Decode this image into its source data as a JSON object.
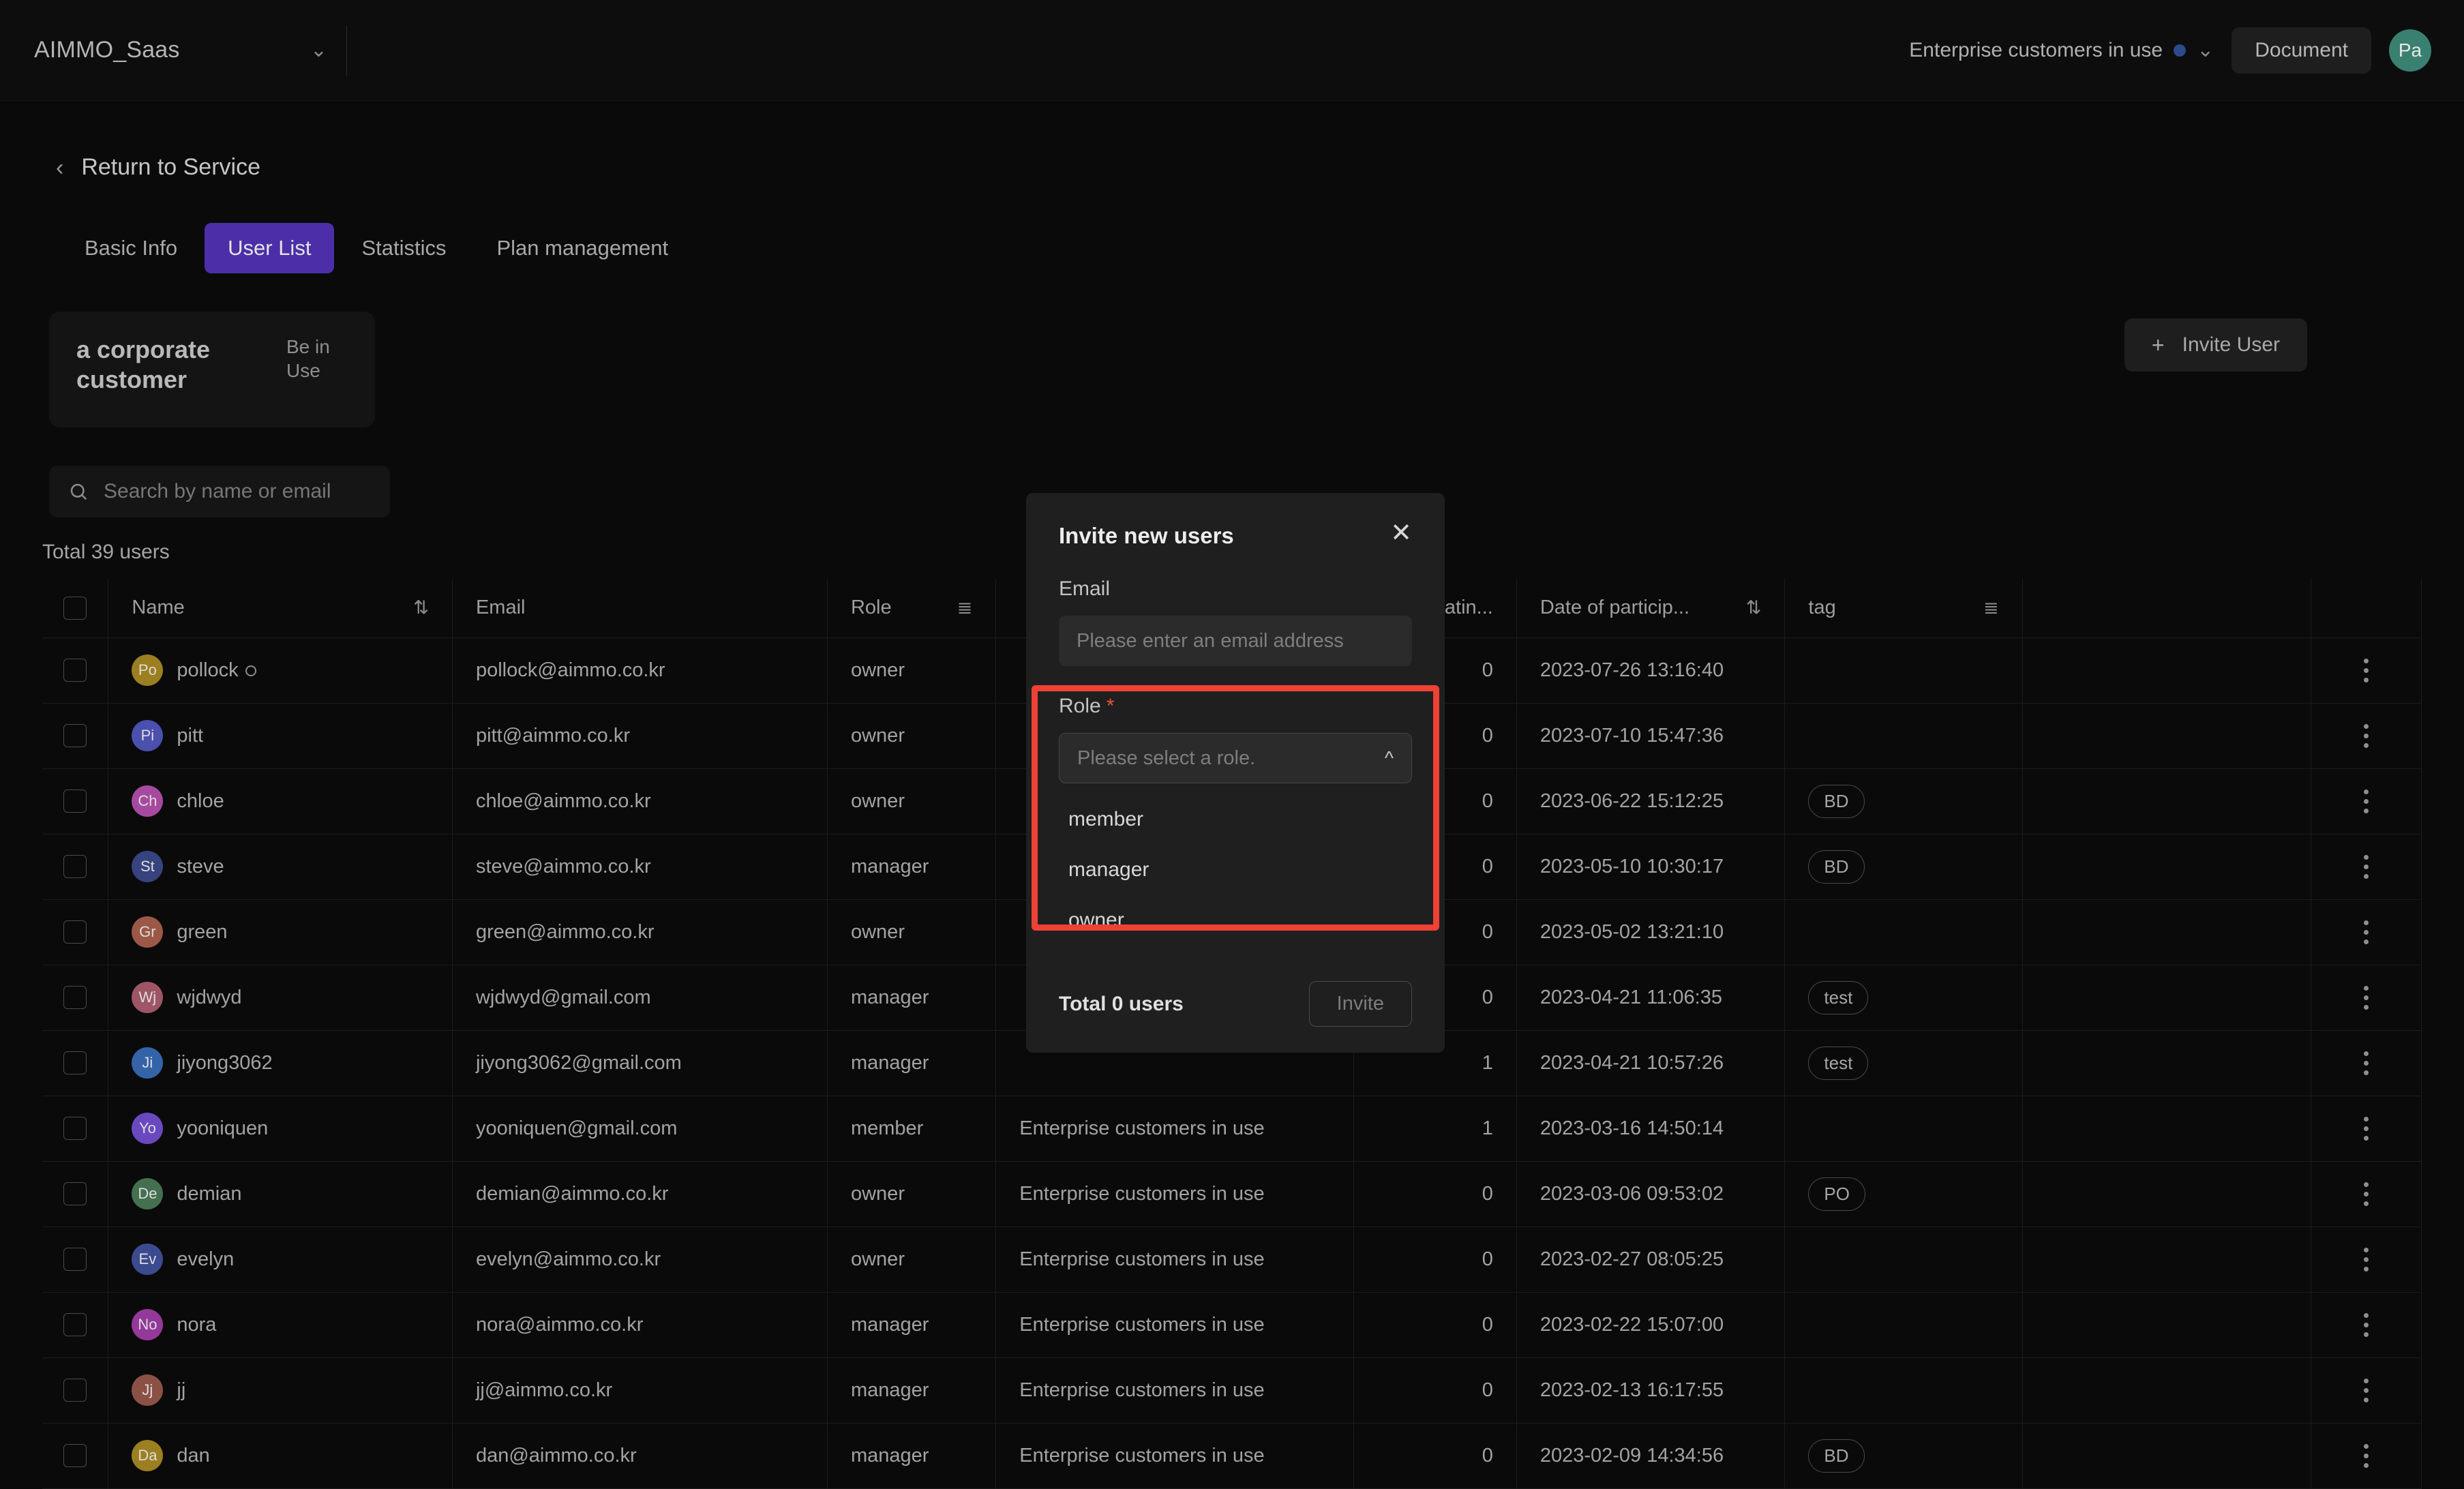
{
  "topbar": {
    "brand": "AIMMO_Saas",
    "enterprise_selector": "Enterprise customers in use",
    "document_button": "Document",
    "avatar_initials": "Pa"
  },
  "nav": {
    "back_label": "Return to Service",
    "tabs": [
      {
        "label": "Basic Info",
        "active": false
      },
      {
        "label": "User List",
        "active": true
      },
      {
        "label": "Statistics",
        "active": false
      },
      {
        "label": "Plan management",
        "active": false
      }
    ]
  },
  "customer_card": {
    "title": "a corporate customer",
    "status": "Be in Use"
  },
  "actions": {
    "invite_user_button": "Invite User"
  },
  "search": {
    "placeholder": "Search by name or email",
    "value": ""
  },
  "list": {
    "total_label": "Total 39 users",
    "columns": [
      {
        "key": "name",
        "label": "Name",
        "control": "sort"
      },
      {
        "key": "email",
        "label": "Email",
        "control": ""
      },
      {
        "key": "role",
        "label": "Role",
        "control": "filter"
      },
      {
        "key": "plan",
        "label": "",
        "control": ""
      },
      {
        "key": "participating",
        "label": "Participatin...",
        "control": ""
      },
      {
        "key": "date",
        "label": "Date of particip...",
        "control": "sort"
      },
      {
        "key": "tag",
        "label": "tag",
        "control": "filter"
      }
    ],
    "rows": [
      {
        "initials": "Po",
        "color": "#9c7f20",
        "name": "pollock",
        "ring": true,
        "email": "pollock@aimmo.co.kr",
        "role": "owner",
        "plan": "",
        "participating": "0",
        "date": "2023-07-26 13:16:40",
        "tag": ""
      },
      {
        "initials": "Pi",
        "color": "#4b4fae",
        "name": "pitt",
        "ring": false,
        "email": "pitt@aimmo.co.kr",
        "role": "owner",
        "plan": "",
        "participating": "0",
        "date": "2023-07-10 15:47:36",
        "tag": ""
      },
      {
        "initials": "Ch",
        "color": "#a64aa0",
        "name": "chloe",
        "ring": false,
        "email": "chloe@aimmo.co.kr",
        "role": "owner",
        "plan": "",
        "participating": "0",
        "date": "2023-06-22 15:12:25",
        "tag": "BD"
      },
      {
        "initials": "St",
        "color": "#37437f",
        "name": "steve",
        "ring": false,
        "email": "steve@aimmo.co.kr",
        "role": "manager",
        "plan": "",
        "participating": "0",
        "date": "2023-05-10 10:30:17",
        "tag": "BD"
      },
      {
        "initials": "Gr",
        "color": "#9c5846",
        "name": "green",
        "ring": false,
        "email": "green@aimmo.co.kr",
        "role": "owner",
        "plan": "",
        "participating": "0",
        "date": "2023-05-02 13:21:10",
        "tag": ""
      },
      {
        "initials": "Wj",
        "color": "#9e5565",
        "name": "wjdwyd",
        "ring": false,
        "email": "wjdwyd@gmail.com",
        "role": "manager",
        "plan": "",
        "participating": "0",
        "date": "2023-04-21 11:06:35",
        "tag": "test"
      },
      {
        "initials": "Ji",
        "color": "#3463a8",
        "name": "jiyong3062",
        "ring": false,
        "email": "jiyong3062@gmail.com",
        "role": "manager",
        "plan": "",
        "participating": "1",
        "date": "2023-04-21 10:57:26",
        "tag": "test"
      },
      {
        "initials": "Yo",
        "color": "#6a49c0",
        "name": "yooniquen",
        "ring": false,
        "email": "yooniquen@gmail.com",
        "role": "member",
        "plan": "Enterprise customers in use",
        "participating": "1",
        "date": "2023-03-16 14:50:14",
        "tag": ""
      },
      {
        "initials": "De",
        "color": "#44704f",
        "name": "demian",
        "ring": false,
        "email": "demian@aimmo.co.kr",
        "role": "owner",
        "plan": "Enterprise customers in use",
        "participating": "0",
        "date": "2023-03-06 09:53:02",
        "tag": "PO"
      },
      {
        "initials": "Ev",
        "color": "#3c4a8f",
        "name": "evelyn",
        "ring": false,
        "email": "evelyn@aimmo.co.kr",
        "role": "owner",
        "plan": "Enterprise customers in use",
        "participating": "0",
        "date": "2023-02-27 08:05:25",
        "tag": ""
      },
      {
        "initials": "No",
        "color": "#94399a",
        "name": "nora",
        "ring": false,
        "email": "nora@aimmo.co.kr",
        "role": "manager",
        "plan": "Enterprise customers in use",
        "participating": "0",
        "date": "2023-02-22 15:07:00",
        "tag": ""
      },
      {
        "initials": "Jj",
        "color": "#8c5145",
        "name": "jj",
        "ring": false,
        "email": "jj@aimmo.co.kr",
        "role": "manager",
        "plan": "Enterprise customers in use",
        "participating": "0",
        "date": "2023-02-13 16:17:55",
        "tag": ""
      },
      {
        "initials": "Da",
        "color": "#9c7f20",
        "name": "dan",
        "ring": false,
        "email": "dan@aimmo.co.kr",
        "role": "manager",
        "plan": "Enterprise customers in use",
        "participating": "0",
        "date": "2023-02-09 14:34:56",
        "tag": "BD"
      }
    ]
  },
  "modal": {
    "title": "Invite new users",
    "email_label": "Email",
    "email_placeholder": "Please enter an email address",
    "email_value": "",
    "role_label": "Role",
    "role_required_mark": "*",
    "role_placeholder": "Please select a role.",
    "role_options": [
      "member",
      "manager",
      "owner"
    ],
    "total_label": "Total 0 users",
    "invite_button": "Invite",
    "highlight_color": "#ef4136"
  }
}
